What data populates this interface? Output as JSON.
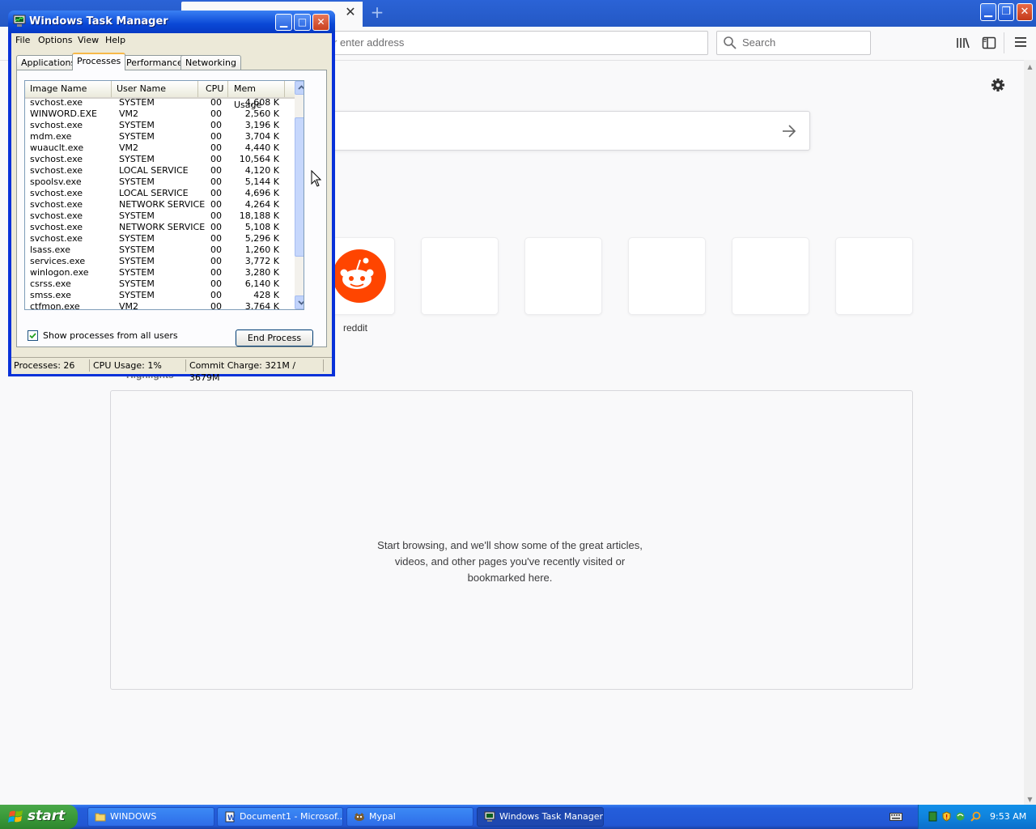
{
  "browser": {
    "tab_close": "✕",
    "new_tab": "+",
    "url_placeholder": "r enter address",
    "search_placeholder": "Search",
    "top_site_label": "reddit",
    "highlights_heading": "Highlights",
    "highlights_message_lines": [
      "Start browsing, and we'll show some of the great articles,",
      "videos, and other pages you've recently visited or",
      "bookmarked here."
    ]
  },
  "task_manager": {
    "title": "Windows Task Manager",
    "menu": [
      "File",
      "Options",
      "View",
      "Help"
    ],
    "tabs": [
      "Applications",
      "Processes",
      "Performance",
      "Networking"
    ],
    "active_tab": "Processes",
    "columns": [
      "Image Name",
      "User Name",
      "CPU",
      "Mem Usage"
    ],
    "processes": [
      {
        "name": "svchost.exe",
        "user": "SYSTEM",
        "cpu": "00",
        "mem": "4,608 K"
      },
      {
        "name": "WINWORD.EXE",
        "user": "VM2",
        "cpu": "00",
        "mem": "2,560 K"
      },
      {
        "name": "svchost.exe",
        "user": "SYSTEM",
        "cpu": "00",
        "mem": "3,196 K"
      },
      {
        "name": "mdm.exe",
        "user": "SYSTEM",
        "cpu": "00",
        "mem": "3,704 K"
      },
      {
        "name": "wuauclt.exe",
        "user": "VM2",
        "cpu": "00",
        "mem": "4,440 K"
      },
      {
        "name": "svchost.exe",
        "user": "SYSTEM",
        "cpu": "00",
        "mem": "10,564 K"
      },
      {
        "name": "svchost.exe",
        "user": "LOCAL SERVICE",
        "cpu": "00",
        "mem": "4,120 K"
      },
      {
        "name": "spoolsv.exe",
        "user": "SYSTEM",
        "cpu": "00",
        "mem": "5,144 K"
      },
      {
        "name": "svchost.exe",
        "user": "LOCAL SERVICE",
        "cpu": "00",
        "mem": "4,696 K"
      },
      {
        "name": "svchost.exe",
        "user": "NETWORK SERVICE",
        "cpu": "00",
        "mem": "4,264 K"
      },
      {
        "name": "svchost.exe",
        "user": "SYSTEM",
        "cpu": "00",
        "mem": "18,188 K"
      },
      {
        "name": "svchost.exe",
        "user": "NETWORK SERVICE",
        "cpu": "00",
        "mem": "5,108 K"
      },
      {
        "name": "svchost.exe",
        "user": "SYSTEM",
        "cpu": "00",
        "mem": "5,296 K"
      },
      {
        "name": "lsass.exe",
        "user": "SYSTEM",
        "cpu": "00",
        "mem": "1,260 K"
      },
      {
        "name": "services.exe",
        "user": "SYSTEM",
        "cpu": "00",
        "mem": "3,772 K"
      },
      {
        "name": "winlogon.exe",
        "user": "SYSTEM",
        "cpu": "00",
        "mem": "3,280 K"
      },
      {
        "name": "csrss.exe",
        "user": "SYSTEM",
        "cpu": "00",
        "mem": "6,140 K"
      },
      {
        "name": "smss.exe",
        "user": "SYSTEM",
        "cpu": "00",
        "mem": "428 K"
      },
      {
        "name": "ctfmon.exe",
        "user": "VM2",
        "cpu": "00",
        "mem": "3,764 K"
      }
    ],
    "show_all_users_label": "Show processes from all users",
    "show_all_users_checked": true,
    "end_process_label": "End Process",
    "status": {
      "processes": "Processes: 26",
      "cpu": "CPU Usage: 1%",
      "commit": "Commit Charge: 321M / 3679M"
    }
  },
  "taskbar": {
    "start_label": "start",
    "items": [
      {
        "label": "WINDOWS",
        "icon": "folder-icon"
      },
      {
        "label": "Document1 - Microsof...",
        "icon": "word-icon"
      },
      {
        "label": "Mypal",
        "icon": "mypal-icon"
      },
      {
        "label": "Windows Task Manager",
        "icon": "task-manager-icon"
      }
    ],
    "clock": "9:53 AM"
  },
  "colors": {
    "xp_blue": "#0831d9",
    "start_green": "#3a9a3a",
    "reddit_orange": "#ff4500"
  }
}
